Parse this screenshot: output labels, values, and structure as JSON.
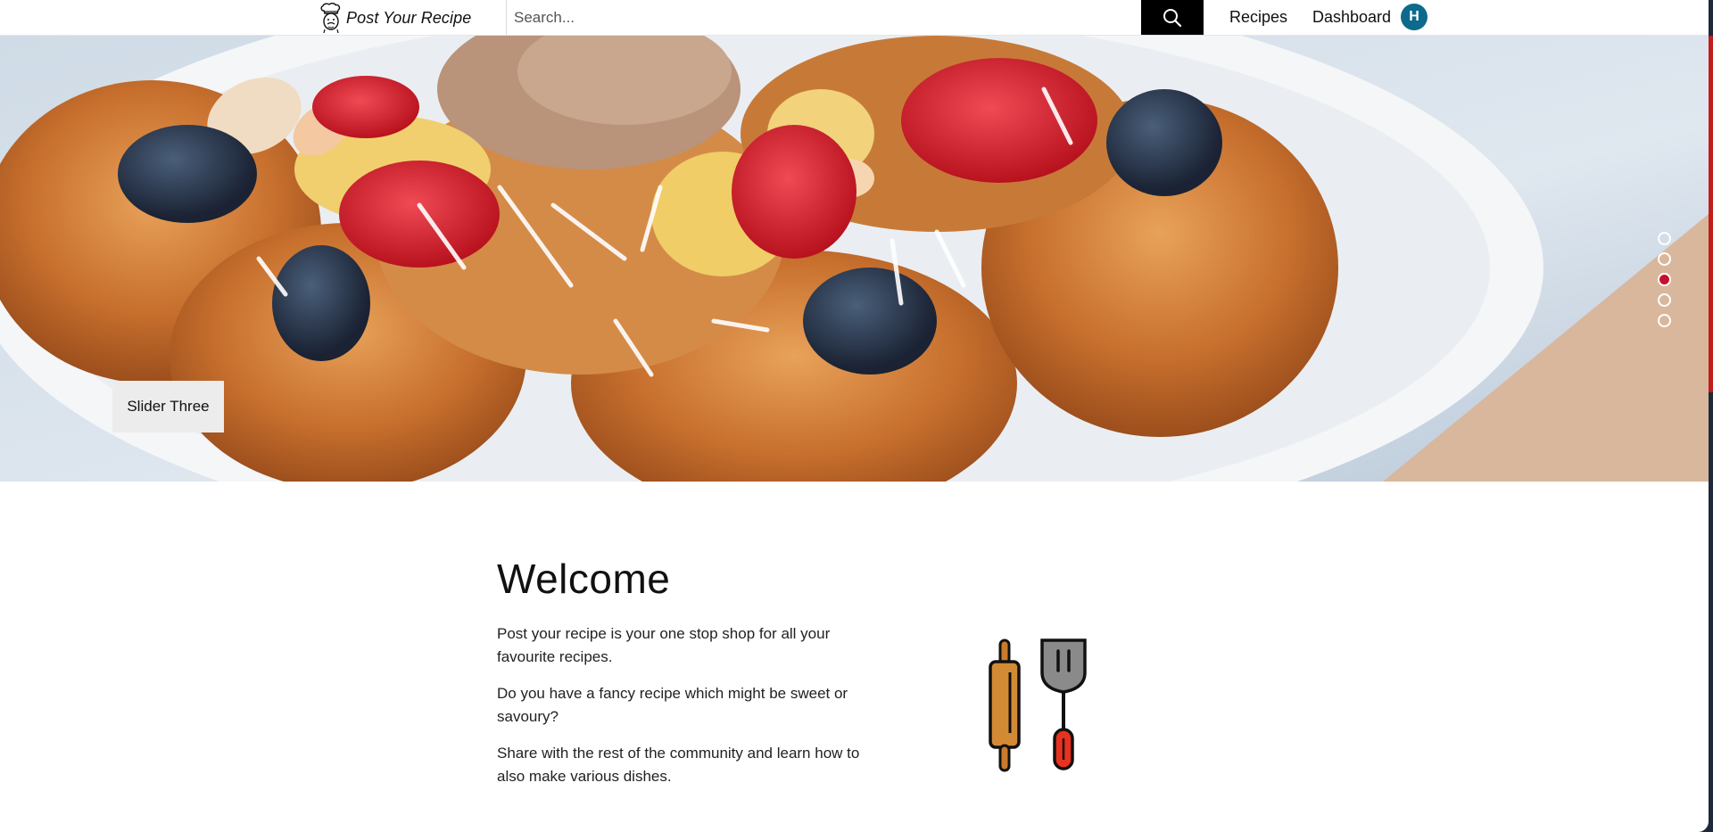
{
  "header": {
    "brand_name": "Post Your Recipe",
    "logo_icon": "chef-icon",
    "search": {
      "placeholder": "Search...",
      "value": ""
    },
    "search_icon": "search-icon",
    "nav": {
      "recipes": "Recipes",
      "dashboard": "Dashboard"
    },
    "avatar_initial": "H",
    "avatar_color": "#0d6a8c"
  },
  "hero": {
    "caption": "Slider Three",
    "slides_total": 5,
    "active_slide_index": 2,
    "active_dot_color": "#c8102e"
  },
  "welcome": {
    "title": "Welcome",
    "paragraphs": [
      "Post your recipe is your one stop shop for all your favourite recipes.",
      "Do you have a fancy recipe which might be sweet or savoury?",
      "Share with the rest of the community and learn how to also make various dishes."
    ],
    "illustration_icon": "rolling-pin-spatula-icon"
  }
}
